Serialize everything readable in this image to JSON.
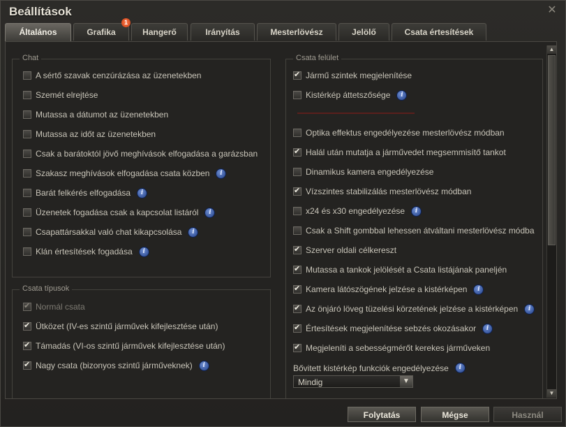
{
  "window": {
    "title": "Beállítások",
    "close_glyph": "✕"
  },
  "tabs": [
    {
      "label": "Általános",
      "active": true
    },
    {
      "label": "Grafika",
      "badge": "1"
    },
    {
      "label": "Hangerő"
    },
    {
      "label": "Irányítás"
    },
    {
      "label": "Mesterlövész"
    },
    {
      "label": "Jelölő"
    },
    {
      "label": "Csata értesítések"
    }
  ],
  "chat": {
    "title": "Chat",
    "items": [
      {
        "label": "A sértő szavak cenzúrázása az üzenetekben",
        "checked": false,
        "info": false
      },
      {
        "label": "Szemét elrejtése",
        "checked": false,
        "info": false
      },
      {
        "label": "Mutassa a dátumot az üzenetekben",
        "checked": false,
        "info": false
      },
      {
        "label": "Mutassa az időt az üzenetekben",
        "checked": false,
        "info": false
      },
      {
        "label": "Csak a barátoktól jövő meghívások elfogadása a garázsban",
        "checked": false,
        "info": false
      },
      {
        "label": "Szakasz meghívások elfogadása csata közben",
        "checked": false,
        "info": true
      },
      {
        "label": "Barát felkérés elfogadása",
        "checked": false,
        "info": true
      },
      {
        "label": "Üzenetek fogadása csak a kapcsolat listáról",
        "checked": false,
        "info": true
      },
      {
        "label": "Csapattársakkal való chat kikapcsolása",
        "checked": false,
        "info": true
      },
      {
        "label": "Klán értesítések fogadása",
        "checked": false,
        "info": true
      }
    ]
  },
  "battle_types": {
    "title": "Csata típusok",
    "items": [
      {
        "label": "Normál csata",
        "checked": true,
        "info": false,
        "disabled": true
      },
      {
        "label": "Ütközet (IV-es szintű járművek kifejlesztése után)",
        "checked": true,
        "info": false
      },
      {
        "label": "Támadás (VI-os szintű járművek kifejlesztése után)",
        "checked": true,
        "info": false
      },
      {
        "label": "Nagy csata (bizonyos szintű járműveknek)",
        "checked": true,
        "info": true
      }
    ]
  },
  "battle_ui": {
    "title": "Csata felület",
    "items": [
      {
        "label": "Jármű szintek megjelenítése",
        "checked": true,
        "info": false
      },
      {
        "label": "Kistérkép áttetszősége",
        "checked": false,
        "info": true
      },
      {
        "label": "Optika effektus engedélyezése mesterlövész módban",
        "checked": false,
        "info": false
      },
      {
        "label": "Halál után mutatja a járművedet megsemmisítő tankot",
        "checked": true,
        "info": false
      },
      {
        "label": "Dinamikus kamera engedélyezése",
        "checked": false,
        "info": false
      },
      {
        "label": "Vízszintes stabilizálás mesterlövész módban",
        "checked": true,
        "info": false
      },
      {
        "label": "x24 és x30 engedélyezése",
        "checked": false,
        "info": true
      },
      {
        "label": "Csak a Shift gombbal lehessen átváltani mesterlövész módba",
        "checked": false,
        "info": false
      },
      {
        "label": "Szerver oldali célkereszt",
        "checked": true,
        "info": false
      },
      {
        "label": "Mutassa a tankok jelölését a Csata listájának paneljén",
        "checked": true,
        "info": false
      },
      {
        "label": "Kamera látószögének jelzése a kistérképen",
        "checked": true,
        "info": true
      },
      {
        "label": "Az önjáró löveg tüzelési körzetének jelzése a kistérképen",
        "checked": true,
        "info": true
      },
      {
        "label": "Értesítések megjelenítése sebzés okozásakor",
        "checked": true,
        "info": true
      },
      {
        "label": "Megjeleníti a sebességmérőt kerekes járműveken",
        "checked": true,
        "info": false
      }
    ],
    "minimap_label": "Bővitett kistérkép funkciók engedélyezése",
    "minimap_value": "Mindig"
  },
  "scroll": {
    "up_glyph": "▲",
    "down_glyph": "▼"
  },
  "select_arrow_glyph": "▼",
  "info_glyph": "i",
  "buttons": {
    "continue": "Folytatás",
    "cancel": "Mégse",
    "apply": "Használ"
  },
  "colors": {
    "tab_active": "#6a6761",
    "badge": "#d9501e",
    "info": "#2f52a8",
    "slider": "#5a1f1c"
  }
}
